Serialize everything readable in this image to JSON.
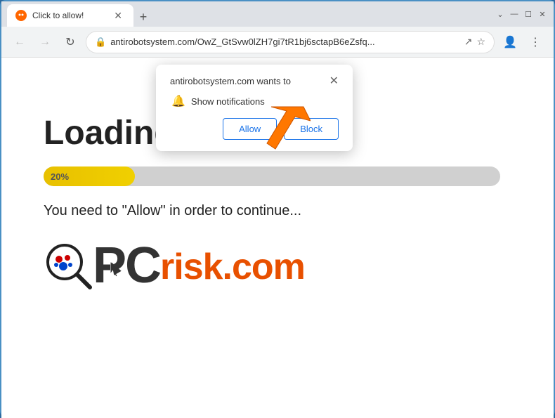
{
  "titlebar": {
    "tab_title": "Click to allow!",
    "new_tab_symbol": "+",
    "chevron_down": "⌄",
    "minimize": "—",
    "maximize": "☐",
    "close": "✕"
  },
  "navbar": {
    "back": "←",
    "forward": "→",
    "refresh": "↻",
    "address": "antirobotsystem.com/OwZ_GtSvw0lZH7gi7tR1bj6sctapB6eZsfq...",
    "share_icon": "↗",
    "star_icon": "☆",
    "profile_icon": "👤",
    "menu_icon": "⋮"
  },
  "popup": {
    "text": "antirobotsystem.com wants to",
    "close_symbol": "✕",
    "notification_label": "Show notifications",
    "allow_label": "Allow",
    "block_label": "Block"
  },
  "page": {
    "loading_text": "Loading...",
    "progress_percent": "20%",
    "instruction": "You need to \"Allow\" in order to continue...",
    "pcrisk_pc": "PC",
    "pcrisk_risk": "risk.com"
  }
}
